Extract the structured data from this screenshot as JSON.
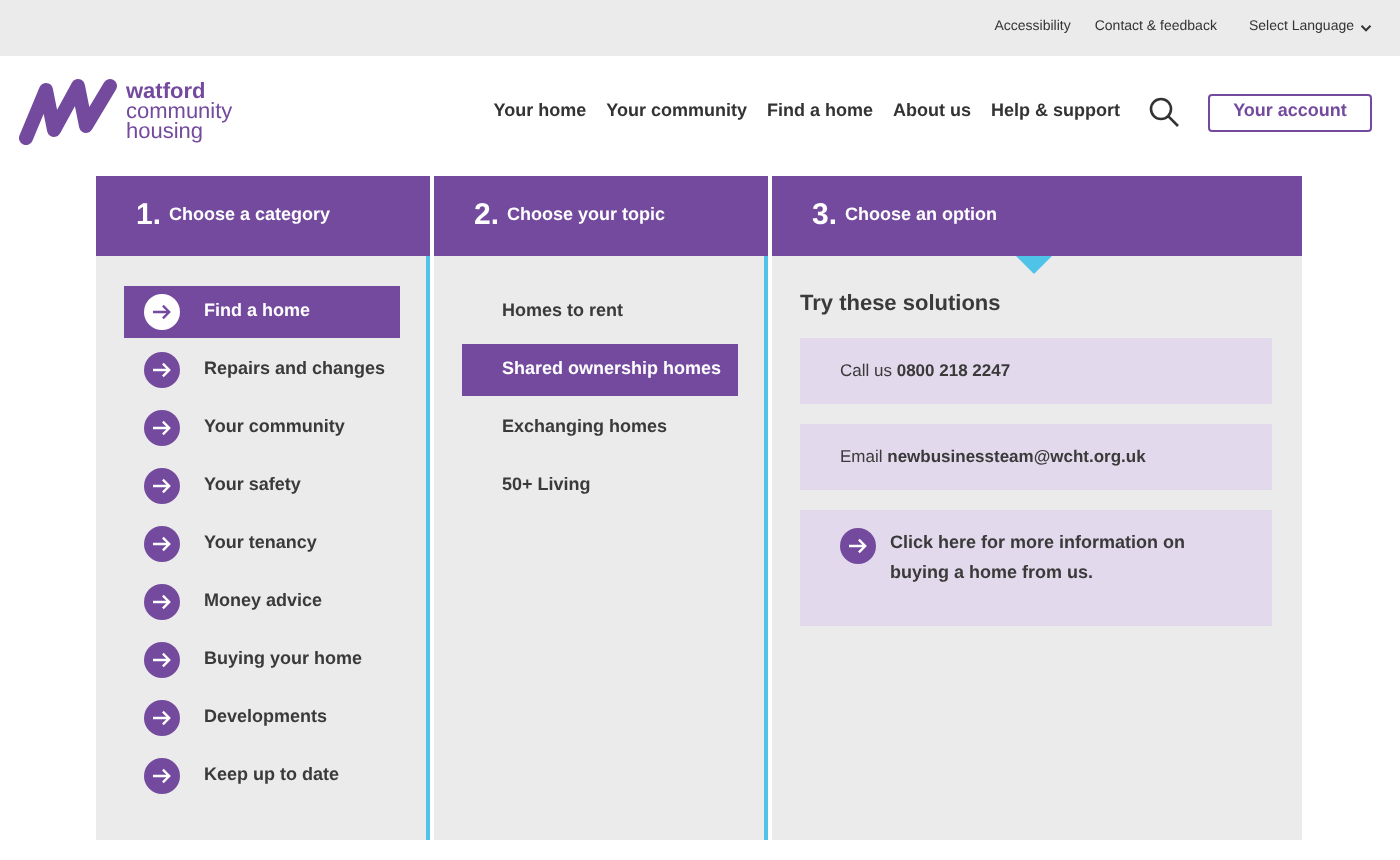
{
  "utility_bar": {
    "links": [
      "Accessibility",
      "Contact & feedback"
    ],
    "language_select": "Select Language"
  },
  "header": {
    "logo_text": [
      "watford",
      "community",
      "housing"
    ],
    "nav": [
      "Your home",
      "Your community",
      "Find a home",
      "About us",
      "Help & support"
    ],
    "account_button": "Your account"
  },
  "columns": [
    {
      "number": "1.",
      "title": "Choose a category",
      "items": [
        {
          "label": "Find a home",
          "selected": true
        },
        {
          "label": "Repairs and changes",
          "selected": false
        },
        {
          "label": "Your community",
          "selected": false
        },
        {
          "label": "Your safety",
          "selected": false
        },
        {
          "label": "Your tenancy",
          "selected": false
        },
        {
          "label": "Money advice",
          "selected": false
        },
        {
          "label": "Buying your home",
          "selected": false
        },
        {
          "label": "Developments",
          "selected": false
        },
        {
          "label": "Keep up to date",
          "selected": false
        }
      ]
    },
    {
      "number": "2.",
      "title": "Choose your topic",
      "items": [
        {
          "label": "Homes to rent",
          "selected": false
        },
        {
          "label": "Shared ownership homes",
          "selected": true
        },
        {
          "label": "Exchanging homes",
          "selected": false
        },
        {
          "label": "50+ Living",
          "selected": false
        }
      ]
    },
    {
      "number": "3.",
      "title": "Choose an option",
      "heading": "Try these solutions",
      "solutions": [
        {
          "kind": "text",
          "text": "Call us **0800 218 2247**"
        },
        {
          "kind": "text",
          "text": "Email **newbusinessteam@wcht.org.uk**"
        },
        {
          "kind": "link",
          "text": "Click here for more information on buying a home from us."
        }
      ]
    }
  ]
}
